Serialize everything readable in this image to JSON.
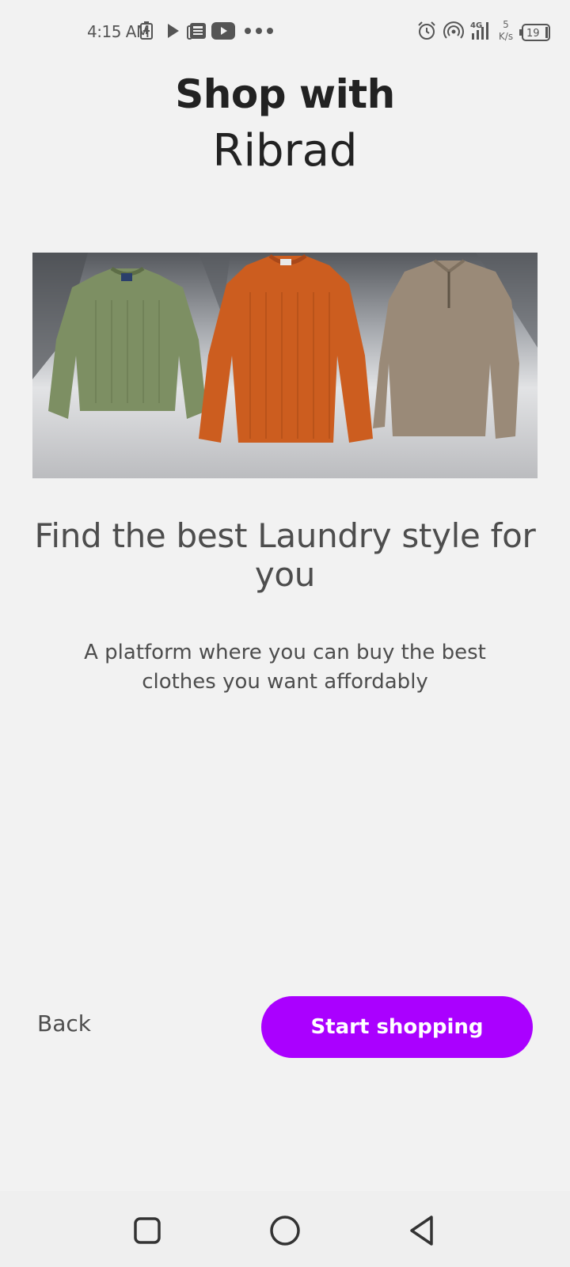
{
  "status_bar": {
    "time": "4:15 AM",
    "icons": [
      "battery-saver-icon",
      "play-icon",
      "news-icon",
      "youtube-icon",
      "more-dots-icon",
      "alarm-icon",
      "hotspot-icon",
      "signal-4g-icon",
      "battery-icon"
    ],
    "net_speed_value": "5",
    "net_speed_unit": "K/s",
    "battery_level": "19"
  },
  "header": {
    "line1": "Shop with",
    "brand": "Ribrad"
  },
  "hero": {
    "icon": "sweaters-image",
    "colors": [
      "#7d8f63",
      "#cc5d1f",
      "#9a8a78"
    ]
  },
  "content": {
    "headline": "Find the best Laundry style for you",
    "description": "A platform where you can buy the best clothes you want affordably"
  },
  "actions": {
    "back_label": "Back",
    "start_label": "Start shopping",
    "accent_color": "#aa00ff"
  },
  "nav_bar": {
    "icons": [
      "recent-apps-icon",
      "home-icon",
      "back-icon"
    ]
  }
}
